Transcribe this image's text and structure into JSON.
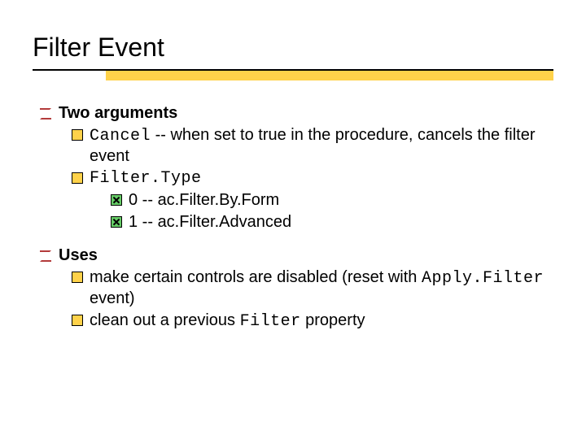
{
  "title": "Filter Event",
  "sections": {
    "args": {
      "heading": "Two arguments",
      "cancel": {
        "code": "Cancel",
        "text": " -- when set to true in the procedure, cancels the filter event"
      },
      "filtertype": {
        "code": "Filter.Type",
        "opt0": {
          "num": "0 -- ",
          "val": "ac.Filter.By.Form"
        },
        "opt1": {
          "num": "1 -- ",
          "val": "ac.Filter.Advanced"
        }
      }
    },
    "uses": {
      "heading": "Uses",
      "u1": {
        "pre": "make certain controls are disabled (reset with ",
        "code": "Apply.Filter",
        "post": " event)"
      },
      "u2": {
        "pre": "clean out a previous ",
        "code": "Filter",
        "post": " property"
      }
    }
  }
}
